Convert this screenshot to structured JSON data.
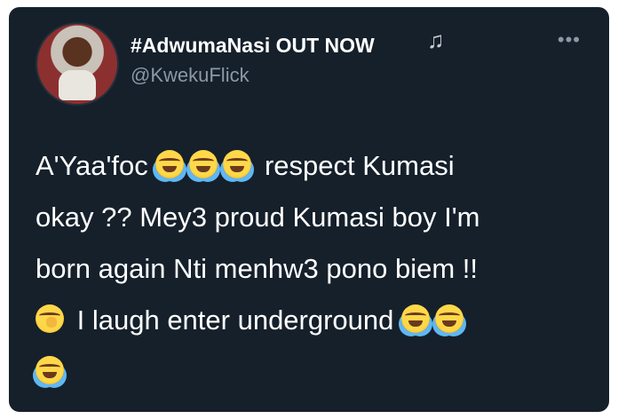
{
  "author": {
    "display_name": "#AdwumaNasi OUT NOW",
    "handle": "@KwekuFlick",
    "status_icon": "music-notes-icon"
  },
  "tweet": {
    "line1_text": "A'Yaa'foc",
    "line1_after": "respect Kumasi",
    "line2": "okay ?? Mey3 proud Kumasi boy I'm",
    "line3": "born again Nti menhw3 pono biem !!",
    "line4": "I laugh enter underground",
    "emojis": [
      "face-with-tears-of-joy",
      "face-with-tears-of-joy",
      "face-with-tears-of-joy",
      "face-with-hand-over-mouth",
      "rolling-on-the-floor-laughing",
      "rolling-on-the-floor-laughing",
      "rolling-on-the-floor-laughing"
    ]
  },
  "menu_icon": "more-options-icon",
  "colors": {
    "background": "#15202b",
    "text": "#ffffff",
    "secondary": "#8b98a5"
  }
}
